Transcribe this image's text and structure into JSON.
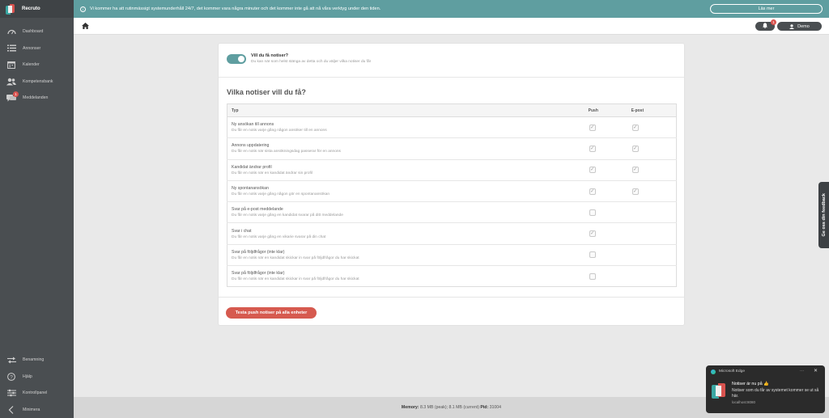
{
  "app": {
    "brand": "Recruto"
  },
  "sidebar": {
    "items": [
      {
        "label": "Dashboard",
        "icon": "dashboard-icon"
      },
      {
        "label": "Annonser",
        "icon": "list-icon"
      },
      {
        "label": "Kalender",
        "icon": "calendar-icon"
      },
      {
        "label": "Kompetensbank",
        "icon": "users-icon"
      },
      {
        "label": "Meddelanden",
        "icon": "chat-icon",
        "badge": "1"
      }
    ],
    "bottom_items": [
      {
        "label": "Benamning",
        "icon": "swap-icon"
      },
      {
        "label": "Hjälp",
        "icon": "help-icon"
      },
      {
        "label": "Kontrollpanel",
        "icon": "sliders-icon"
      },
      {
        "label": "Minimera",
        "icon": "chevron-left-icon"
      }
    ]
  },
  "banner": {
    "text": "Vi kommer ha att rutinmässigt systemunderhåll 24/7, det kommer vara några minuter och det kommer inte gå att nå våra verktyg under den tiden.",
    "button": "Läs mer"
  },
  "header": {
    "bell_badge": "1",
    "user_name": "Demo"
  },
  "settings": {
    "toggle_title": "Vill du få notiser?",
    "toggle_desc": "Du kan när som helst stänga av detta och du väljer vilka notiser du får",
    "section_title": "Vilka notiser vill du få?",
    "columns": {
      "type": "Typ",
      "push": "Push",
      "email": "E-post"
    },
    "rows": [
      {
        "title": "Ny ansökan till annons",
        "desc": "Du får en notis varje gång någon ansöker till en annons",
        "push": true,
        "email": true
      },
      {
        "title": "Annons uppdatering",
        "desc": "Du får en notis när sista ansökningsdag passerar för en annons",
        "push": true,
        "email": true
      },
      {
        "title": "Kandidat ändrar profil",
        "desc": "Du får en notis när en kandidat ändrar sin profil",
        "push": true,
        "email": true
      },
      {
        "title": "Ny spontanansökan",
        "desc": "Du får en notis varje gång någon gör en spontanansökan",
        "push": true,
        "email": true
      },
      {
        "title": "Svar på e-post meddelande",
        "desc": "Du får en notis varje gång en kandidat svarar på ditt meddelande",
        "push": false,
        "email": null
      },
      {
        "title": "Svar i chat",
        "desc": "Du får en notis varje gång en vikarie svarar på din chat",
        "push": true,
        "email": null
      },
      {
        "title": "Svar på följdfrågor (inte klar)",
        "desc": "Du får en notis när en kandidat skickar in svar på följdfrågor du har skickat",
        "push": false,
        "email": null
      },
      {
        "title": "Svar på följdfrågor (inte klar)",
        "desc": "Du får en notis när en kandidat skickar in svar på följdfrågor du har skickat",
        "push": false,
        "email": null
      }
    ],
    "test_button": "Testa push notiser på alla enheter"
  },
  "feedback": {
    "label": "Ge oss din feedback"
  },
  "footer": {
    "memory_label": "Memory:",
    "memory_value": "8.3 MB (peak); 8.1 MB (current)",
    "pid_label": "Pid:",
    "pid_value": "31004"
  },
  "toast": {
    "app": "Microsoft Edge",
    "more": "···",
    "title": "Notiser är nu på 👍",
    "body": "Notiser som du får av systemet kommer se ut så här.",
    "source": "localhost:8080"
  },
  "colors": {
    "accent": "#5f9ea0",
    "danger": "#d65a4f",
    "sidebar": "#4a4e51"
  }
}
